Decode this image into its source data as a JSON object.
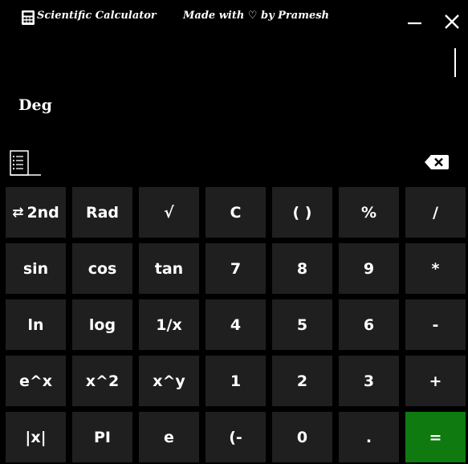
{
  "titlebar": {
    "app_title": "Scientific Calculator",
    "made_with": "Made with ♡ by Pramesh",
    "icons": {
      "app": "calculator-icon",
      "minimize": "minimize-icon",
      "close": "close-icon"
    },
    "minimize_glyph": "—",
    "close_glyph": "✕"
  },
  "display": {
    "mode_label": "Deg",
    "expression": ""
  },
  "tools": {
    "history_icon": "history-icon",
    "backspace_icon": "backspace-icon"
  },
  "colors": {
    "background": "#000000",
    "key": "#1f1f1f",
    "equals": "#0f7a0f",
    "text": "#ffffff"
  },
  "keypad": {
    "row1": {
      "second": "2nd",
      "second_icon": "swap-icon",
      "rad": "Rad",
      "sqrt": "√",
      "clear": "C",
      "parens": "( )",
      "percent": "%",
      "divide": "/"
    },
    "row2": {
      "sin": "sin",
      "cos": "cos",
      "tan": "tan",
      "seven": "7",
      "eight": "8",
      "nine": "9",
      "multiply": "*"
    },
    "row3": {
      "ln": "ln",
      "log": "log",
      "reciprocal": "1/x",
      "four": "4",
      "five": "5",
      "six": "6",
      "subtract": "-"
    },
    "row4": {
      "exp": "e^x",
      "square": "x^2",
      "power": "x^y",
      "one": "1",
      "two": "2",
      "three": "3",
      "add": "+"
    },
    "row5": {
      "abs": "|x|",
      "pi": "PI",
      "e": "e",
      "negate": "(-",
      "zero": "0",
      "decimal": ".",
      "equals": "="
    }
  }
}
